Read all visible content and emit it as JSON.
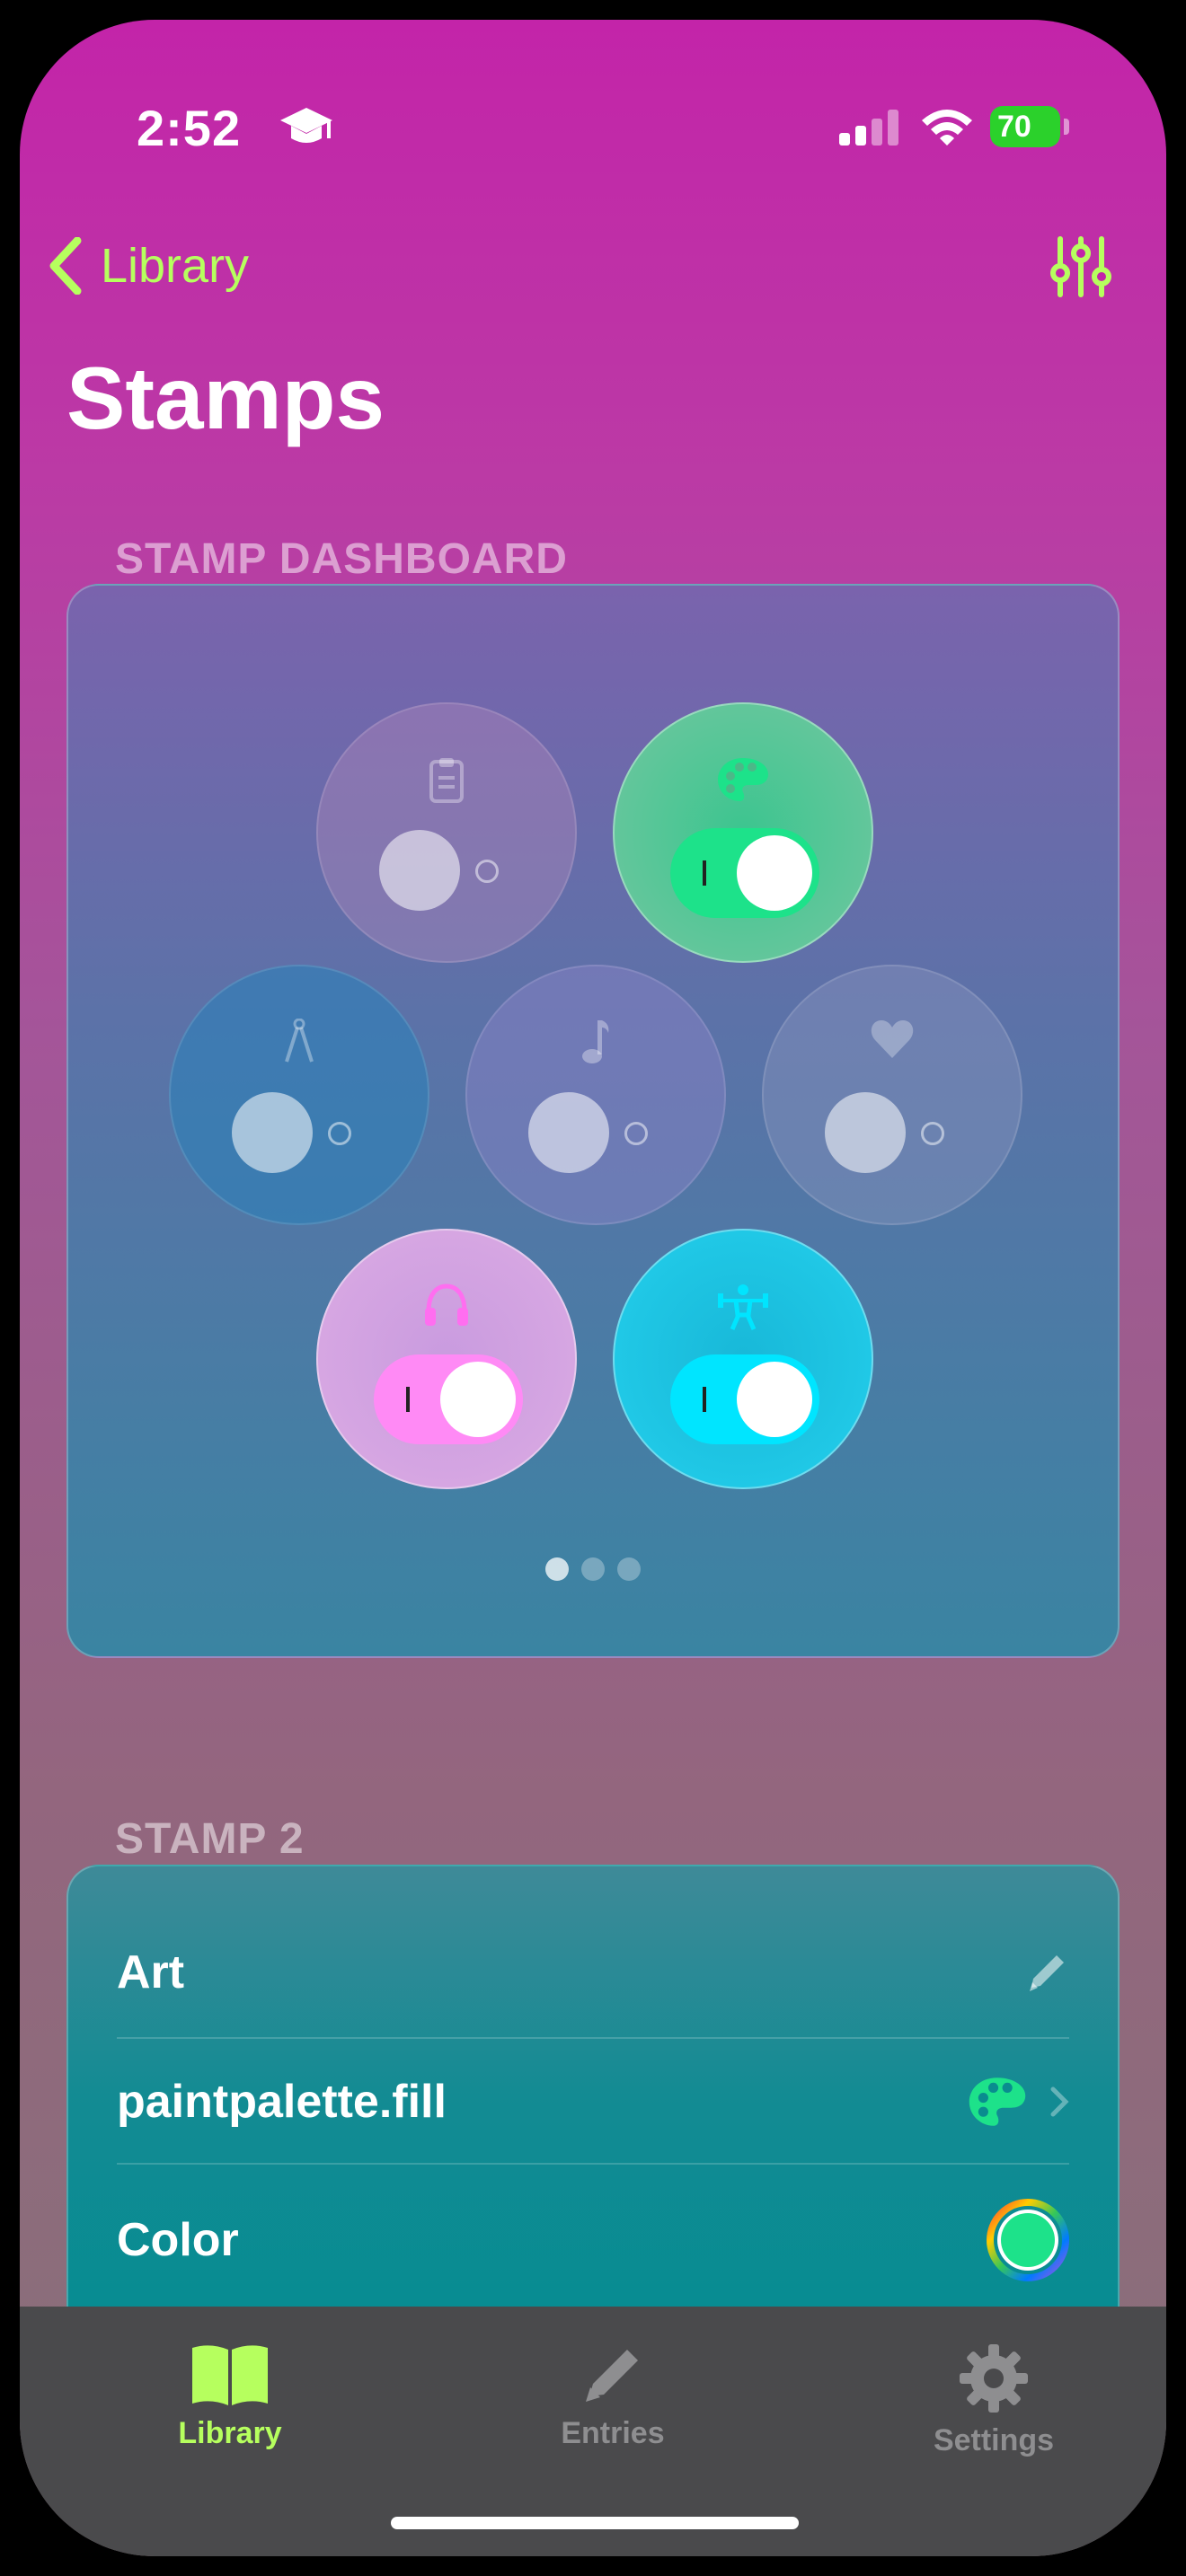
{
  "status_bar": {
    "time": "2:52",
    "battery": "70"
  },
  "nav": {
    "back_label": "Library"
  },
  "page": {
    "title": "Stamps"
  },
  "dashboard": {
    "section_label": "STAMP DASHBOARD",
    "stamps": [
      {
        "icon": "clipboard-icon",
        "on": false,
        "color": "#9a7a9e"
      },
      {
        "icon": "paint-palette-icon",
        "on": true,
        "color": "#1de28a"
      },
      {
        "icon": "compass-icon",
        "on": false,
        "color": "#3f86b0"
      },
      {
        "icon": "music-note-icon",
        "on": false,
        "color": "#7d79b8"
      },
      {
        "icon": "heart-icon",
        "on": false,
        "color": "#7a85b4"
      },
      {
        "icon": "headphones-icon",
        "on": true,
        "color": "#ff8af5"
      },
      {
        "icon": "weightlifter-icon",
        "on": true,
        "color": "#00e5ff"
      }
    ],
    "page_count": 3,
    "current_page": 1
  },
  "stamp2": {
    "section_label": "STAMP 2",
    "name_label": "Art",
    "symbol_label": "paintpalette.fill",
    "color_label": "Color",
    "accent_color": "#1de28a"
  },
  "tabs": [
    {
      "label": "Library",
      "active": true
    },
    {
      "label": "Entries",
      "active": false
    },
    {
      "label": "Settings",
      "active": false
    }
  ],
  "colors": {
    "accent": "#b6ff5e",
    "background_top": "#c324a9"
  }
}
